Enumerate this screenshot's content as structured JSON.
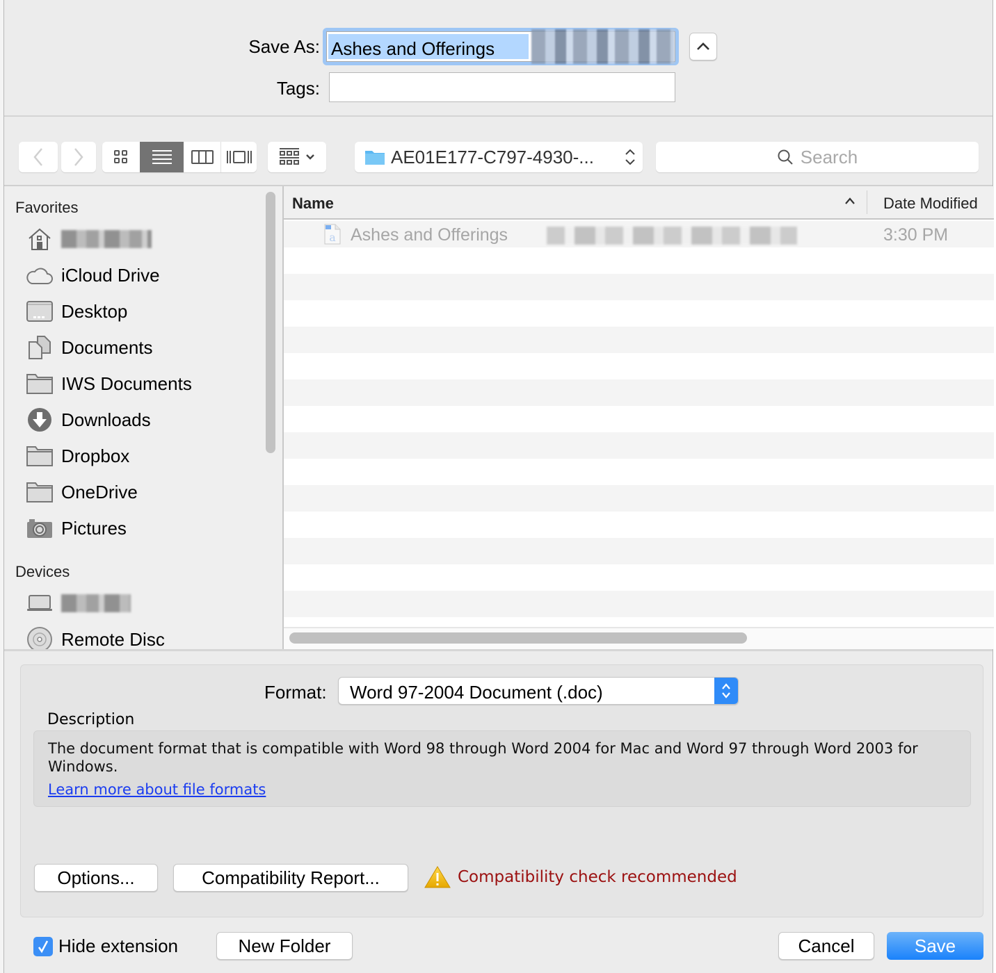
{
  "dialog": {
    "save_as_label": "Save As:",
    "save_as_value": "Ashes and Offerings",
    "tags_label": "Tags:",
    "tags_value": "",
    "expand_icon": "chevron-up-icon"
  },
  "toolbar": {
    "back_icon": "chevron-left-icon",
    "forward_icon": "chevron-right-icon",
    "view_modes": [
      {
        "name": "icon-view",
        "active": false
      },
      {
        "name": "list-view",
        "active": true
      },
      {
        "name": "column-view",
        "active": false
      },
      {
        "name": "cover-flow-view",
        "active": false
      }
    ],
    "arrange_icon": "arrange-grid-icon",
    "location": "AE01E177-C797-4930-...",
    "search_placeholder": "Search"
  },
  "sidebar": {
    "sections": [
      {
        "title": "Favorites",
        "items": [
          {
            "label": "",
            "icon": "home-icon",
            "redacted": true
          },
          {
            "label": "iCloud Drive",
            "icon": "cloud-icon"
          },
          {
            "label": "Desktop",
            "icon": "desktop-icon"
          },
          {
            "label": "Documents",
            "icon": "documents-icon"
          },
          {
            "label": "IWS Documents",
            "icon": "folder-icon"
          },
          {
            "label": "Downloads",
            "icon": "download-icon"
          },
          {
            "label": "Dropbox",
            "icon": "folder-icon"
          },
          {
            "label": "OneDrive",
            "icon": "folder-icon"
          },
          {
            "label": "Pictures",
            "icon": "camera-icon"
          }
        ]
      },
      {
        "title": "Devices",
        "items": [
          {
            "label": "",
            "icon": "laptop-icon",
            "redacted": true
          },
          {
            "label": "Remote Disc",
            "icon": "disc-icon"
          }
        ]
      }
    ]
  },
  "file_list": {
    "columns": {
      "name": "Name",
      "date_modified": "Date Modified"
    },
    "sort": "ascending",
    "rows": [
      {
        "name": "Ashes and Offerings",
        "date_modified": "3:30 PM",
        "icon": "word-document-icon",
        "dimmed": true
      }
    ]
  },
  "accessory": {
    "format_label": "Format:",
    "format_value": "Word 97-2004 Document (.doc)",
    "description_label": "Description",
    "description_text": "The document format that is compatible with Word 98 through Word 2004 for Mac and Word 97 through Word 2003 for Windows.",
    "learn_more_link": "Learn more about file formats",
    "options_button": "Options...",
    "compatibility_button": "Compatibility Report...",
    "warning_text": "Compatibility check recommended",
    "warning_color": "#9b1010"
  },
  "footer": {
    "hide_extension_label": "Hide extension",
    "hide_extension_checked": true,
    "new_folder_button": "New Folder",
    "cancel_button": "Cancel",
    "save_button": "Save",
    "accent_color": "#1a82fb"
  }
}
